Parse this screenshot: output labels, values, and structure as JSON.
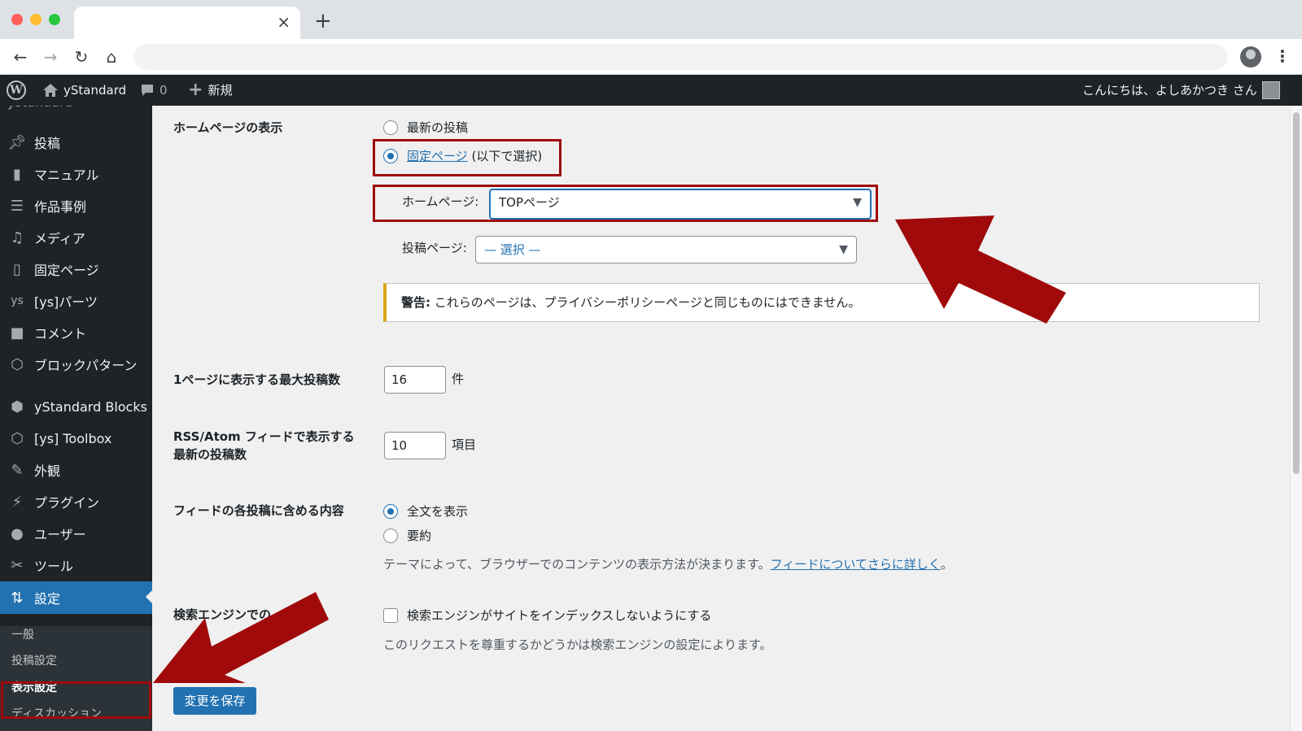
{
  "browser": {
    "tab_close": "×",
    "new_tab": "+"
  },
  "adminbar": {
    "site_name": "yStandard",
    "comments_count": "0",
    "new_label": "新規",
    "greeting": "こんにちは、よしあかつき さん"
  },
  "sidebar": {
    "partial_top": "ystandard",
    "items": [
      {
        "label": "投稿",
        "icon": "pin-icon"
      },
      {
        "label": "マニュアル",
        "icon": "book-icon"
      },
      {
        "label": "作品事例",
        "icon": "list-icon"
      },
      {
        "label": "メディア",
        "icon": "media-icon"
      },
      {
        "label": "固定ページ",
        "icon": "page-icon"
      },
      {
        "label": "[ys]パーツ",
        "icon": "ys-icon"
      },
      {
        "label": "コメント",
        "icon": "comment-icon"
      },
      {
        "label": "ブロックパターン",
        "icon": "hexagon-icon"
      },
      {
        "label": "yStandard Blocks",
        "icon": "cube-icon"
      },
      {
        "label": "[ys] Toolbox",
        "icon": "hexagon-icon"
      },
      {
        "label": "外観",
        "icon": "brush-icon"
      },
      {
        "label": "プラグイン",
        "icon": "plug-icon"
      },
      {
        "label": "ユーザー",
        "icon": "user-icon"
      },
      {
        "label": "ツール",
        "icon": "wrench-icon"
      },
      {
        "label": "設定",
        "icon": "settings-icon"
      }
    ],
    "submenu": [
      "一般",
      "投稿設定",
      "表示設定",
      "ディスカッション"
    ]
  },
  "settings": {
    "homepage_display": {
      "label": "ホームページの表示",
      "option_latest": "最新の投稿",
      "option_static_link": "固定ページ",
      "option_static_suffix": "(以下で選択)",
      "homepage_label": "ホームページ:",
      "homepage_value": "TOPページ",
      "posts_page_label": "投稿ページ:",
      "posts_page_value": "— 選択 —",
      "warning_bold": "警告:",
      "warning_text": "これらのページは、プライバシーポリシーページと同じものにはできません。"
    },
    "posts_per_page": {
      "label": "1ページに表示する最大投稿数",
      "value": "16",
      "unit": "件"
    },
    "rss_count": {
      "label_line1": "RSS/Atom フィードで表示する",
      "label_line2": "最新の投稿数",
      "value": "10",
      "unit": "項目"
    },
    "feed_content": {
      "label": "フィードの各投稿に含める内容",
      "option_full": "全文を表示",
      "option_summary": "要約",
      "desc_text": "テーマによって、ブラウザーでのコンテンツの表示方法が決まります。",
      "desc_link": "フィードについてさらに詳しく",
      "desc_end": "。"
    },
    "search_engine": {
      "label": "検索エンジンでの",
      "checkbox_label": "検索エンジンがサイトをインデックスしないようにする",
      "desc": "このリクエストを尊重するかどうかは検索エンジンの設定によります。"
    },
    "save_button": "変更を保存"
  },
  "colors": {
    "annotation": "#a00a0a",
    "accent": "#2271b1"
  }
}
